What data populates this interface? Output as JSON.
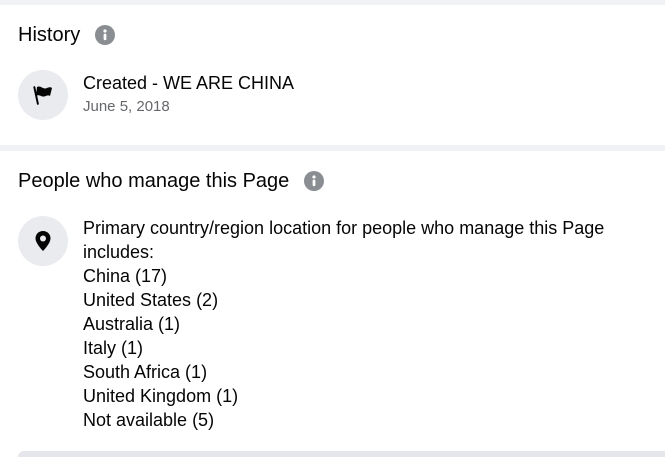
{
  "history": {
    "title": "History",
    "entry_title": "Created - WE ARE CHINA",
    "entry_date": "June 5, 2018",
    "icons": {
      "info": "info-icon",
      "entry": "flag-icon"
    }
  },
  "managers": {
    "title": "People who manage this Page",
    "intro": "Primary country/region location for people who manage this Page includes:",
    "countries": [
      "China (17)",
      "United States (2)",
      "Australia (1)",
      "Italy (1)",
      "South Africa (1)",
      "United Kingdom (1)",
      "Not available (5)"
    ],
    "icons": {
      "info": "info-icon",
      "entry": "location-pin-icon"
    }
  },
  "colors": {
    "page_background": "#f0f2f5",
    "card_background": "#ffffff",
    "secondary_text": "#65676b",
    "icon_gray": "#8a8d91"
  }
}
